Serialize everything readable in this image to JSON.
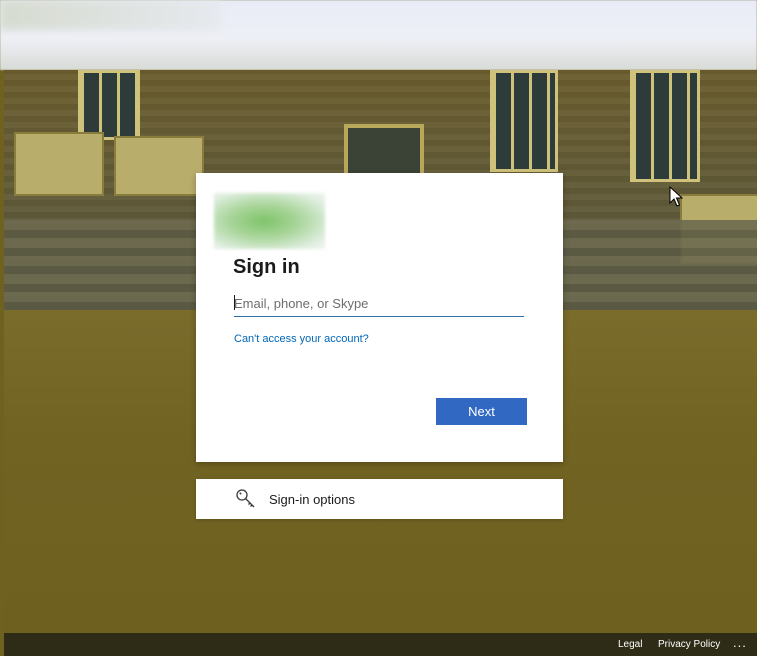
{
  "signin": {
    "title": "Sign in",
    "email_placeholder": "Email, phone, or Skype",
    "email_value": "",
    "cant_access_link": "Can't access your account?",
    "next_button": "Next"
  },
  "options": {
    "label": "Sign-in options",
    "icon": "key-icon"
  },
  "footer": {
    "legal": "Legal",
    "privacy": "Privacy Policy",
    "more": "..."
  },
  "colors": {
    "accent": "#3068c2",
    "link": "#0067b8",
    "background_tint": "#6f6220",
    "footer": "#2e2b16"
  }
}
